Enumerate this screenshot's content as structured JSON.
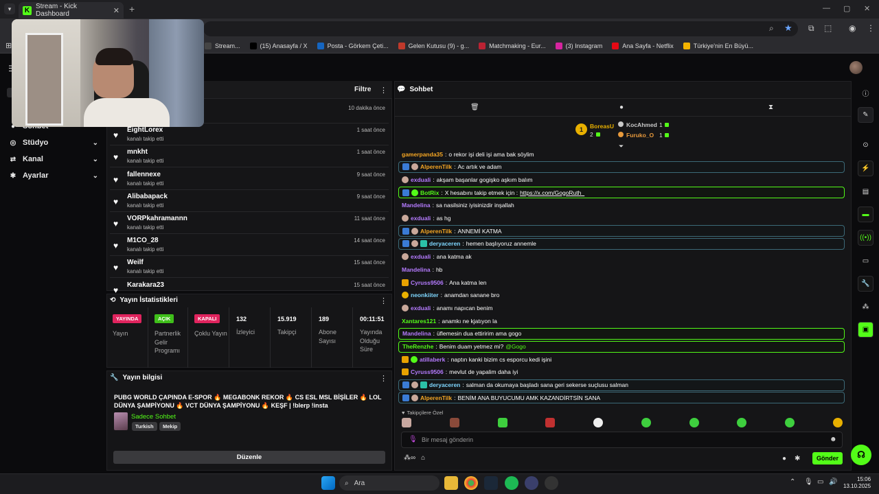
{
  "browser": {
    "tab_title": "Stream - Kick Dashboard",
    "bookmarks": [
      {
        "label": "Stream...",
        "color": "#444"
      },
      {
        "label": "(15) Anasayfa / X",
        "color": "#000"
      },
      {
        "label": "Posta - Görkem Çeti...",
        "color": "#1565c0"
      },
      {
        "label": "Gelen Kutusu (9) - g...",
        "color": "#c0392b"
      },
      {
        "label": "Matchmaking - Eur...",
        "color": "#b23"
      },
      {
        "label": "(3) Instagram",
        "color": "#d6249f"
      },
      {
        "label": "Ana Sayfa - Netflix",
        "color": "#e50914"
      },
      {
        "label": "Türkiye'nin En Büyü...",
        "color": "#f4b400"
      }
    ]
  },
  "sidebar": {
    "items": [
      {
        "label": "Sohbet",
        "icon": "chat-icon"
      },
      {
        "label": "Stüdyo",
        "icon": "studio-icon"
      },
      {
        "label": "Kanal",
        "icon": "channel-icon"
      },
      {
        "label": "Ayarlar",
        "icon": "gear-icon"
      }
    ]
  },
  "activity": {
    "filter_label": "Filtre",
    "rows": [
      {
        "name": "",
        "sub": "",
        "time": "10 dakika önce"
      },
      {
        "name": "EightLorex",
        "sub": "kanalı takip etti",
        "time": "1 saat önce"
      },
      {
        "name": "mnkht",
        "sub": "kanalı takip etti",
        "time": "1 saat önce"
      },
      {
        "name": "fallennexe",
        "sub": "kanalı takip etti",
        "time": "9 saat önce"
      },
      {
        "name": "Alibabapack",
        "sub": "kanalı takip etti",
        "time": "9 saat önce"
      },
      {
        "name": "VORPkahramannn",
        "sub": "kanalı takip etti",
        "time": "11 saat önce"
      },
      {
        "name": "M1CO_28",
        "sub": "kanalı takip etti",
        "time": "14 saat önce"
      },
      {
        "name": "Weilf",
        "sub": "kanalı takip etti",
        "time": "15 saat önce"
      },
      {
        "name": "Karakara23",
        "sub": "",
        "time": "15 saat önce"
      }
    ]
  },
  "stats": {
    "title": "Yayın İstatistikleri",
    "badges": [
      {
        "badge": "YAYINDA",
        "color": "#e0245e",
        "label": "Yayın"
      },
      {
        "badge": "AÇIK",
        "color": "#3fbf1a",
        "label": "Partnerlik Gelir Programı"
      },
      {
        "badge": "KAPALI",
        "color": "#e0245e",
        "label": "Çoklu Yayın"
      }
    ],
    "values": [
      {
        "value": "132",
        "label": "İzleyici"
      },
      {
        "value": "15.919",
        "label": "Takipçi"
      },
      {
        "value": "189",
        "label": "Abone Sayısı"
      },
      {
        "value": "00:11:51",
        "label": "Yayında Olduğu Süre"
      }
    ]
  },
  "info": {
    "title": "Yayın bilgisi",
    "stream_title": "PUBG WORLD ÇAPINDA E-SPOR 🔥 MEGABONK REKOR 🔥 CS ESL MSL BİŞİLER 🔥 LOL DÜNYA ŞAMPİYONU 🔥 VCT DÜNYA ŞAMPİYONU 🔥 KEŞF | !blerp !insta",
    "category": "Sadece Sohbet",
    "tags": [
      "Turkish",
      "Mekip"
    ],
    "edit_label": "Düzenle"
  },
  "chat": {
    "title": "Sohbet",
    "leaderboard": [
      {
        "rank": "1",
        "name": "BoreasU",
        "count": "2",
        "color": "#e8b000"
      },
      {
        "rank": "",
        "name": "KocAhmed",
        "count": "1",
        "color": "#c8c8c8"
      },
      {
        "rank": "",
        "name": "Furuko_O",
        "count": "1",
        "color": "#e89a3c"
      }
    ],
    "messages": [
      {
        "user": "gamerpanda35",
        "color": "#f5a623",
        "text": "o rekor işi deli işi ama bak söylim",
        "badges": [],
        "hl": ""
      },
      {
        "user": "AlperenTilk",
        "color": "#f5a623",
        "text": "Ac artık ve adam",
        "badges": [
          "mod",
          "av"
        ],
        "hl": "blue"
      },
      {
        "user": "exduali",
        "color": "#b57bff",
        "text": "akşam başanlar gogişko aşkım balım",
        "badges": [
          "av"
        ],
        "hl": ""
      },
      {
        "user": "BotRix",
        "color": "#53fc18",
        "text": "X hesabını takip etmek için : ",
        "link": "https://x.com/GogoRuth_",
        "badges": [
          "mod",
          "ver"
        ],
        "hl": "green"
      },
      {
        "user": "Mandelina",
        "color": "#b57bff",
        "text": "sa nasilsiniz iyisinizdir inşallah",
        "badges": [],
        "hl": ""
      },
      {
        "user": "exduali",
        "color": "#b57bff",
        "text": "as hg",
        "badges": [
          "av"
        ],
        "hl": ""
      },
      {
        "user": "AlperenTilk",
        "color": "#f5a623",
        "text": "ANNEMİ KATMA",
        "badges": [
          "mod",
          "av"
        ],
        "hl": "blue"
      },
      {
        "user": "deryaceren",
        "color": "#7fd7ff",
        "text": "hemen başlıyoruz annemle",
        "badges": [
          "mod",
          "av",
          "sub"
        ],
        "hl": "blue"
      },
      {
        "user": "exduali",
        "color": "#b57bff",
        "text": "ana katma ak",
        "badges": [
          "av"
        ],
        "hl": ""
      },
      {
        "user": "Mandelina",
        "color": "#b57bff",
        "text": "hb",
        "badges": [],
        "hl": ""
      },
      {
        "user": "Cyruss9506",
        "color": "#b57bff",
        "text": "Ana katma len",
        "badges": [
          "vip"
        ],
        "hl": ""
      },
      {
        "user": "neonkiiter",
        "color": "#7fd7ff",
        "text": "anamdan sanane bro",
        "badges": [
          "og"
        ],
        "hl": ""
      },
      {
        "user": "exduali",
        "color": "#b57bff",
        "text": "anamı napıcan benim",
        "badges": [
          "av"
        ],
        "hl": ""
      },
      {
        "user": "Xantares121",
        "color": "#53fc18",
        "text": "anamkı ne kjatıyon la",
        "badges": [],
        "hl": ""
      },
      {
        "user": "Mandelina",
        "color": "#b57bff",
        "text": "üflemesin dua ettiririm ama gogo",
        "badges": [],
        "hl": "green"
      },
      {
        "user": "TheRenzhe",
        "color": "#53fc18",
        "text": "Benim duam yetmez mi? ",
        "mention": "@Gogo",
        "badges": [],
        "hl": "green"
      },
      {
        "user": "atillaberk",
        "color": "#b57bff",
        "text": "naptın kanki bizim cs esporcu kedi işini",
        "badges": [
          "vip",
          "ver"
        ],
        "hl": ""
      },
      {
        "user": "Cyruss9506",
        "color": "#b57bff",
        "text": "mevlut de yapalim daha iyi",
        "badges": [
          "vip"
        ],
        "hl": ""
      },
      {
        "user": "deryaceren",
        "color": "#7fd7ff",
        "text": "salman da okumaya başladı sana geri sekerse suçlusu salman",
        "badges": [
          "mod",
          "av",
          "sub"
        ],
        "hl": "blue"
      },
      {
        "user": "AlperenTilk",
        "color": "#f5a623",
        "text": "BENİM ANA BUYUCUMU AMK KAZANDİRTSİN SANA",
        "badges": [
          "mod",
          "av"
        ],
        "hl": "blue"
      }
    ],
    "emote_label": "Takipçilere Özel",
    "input_placeholder": "Bir mesaj gönderin",
    "send_label": "Gönder"
  },
  "taskbar": {
    "search_label": "Ara",
    "time": "15:06",
    "date": "13.10.2025"
  }
}
